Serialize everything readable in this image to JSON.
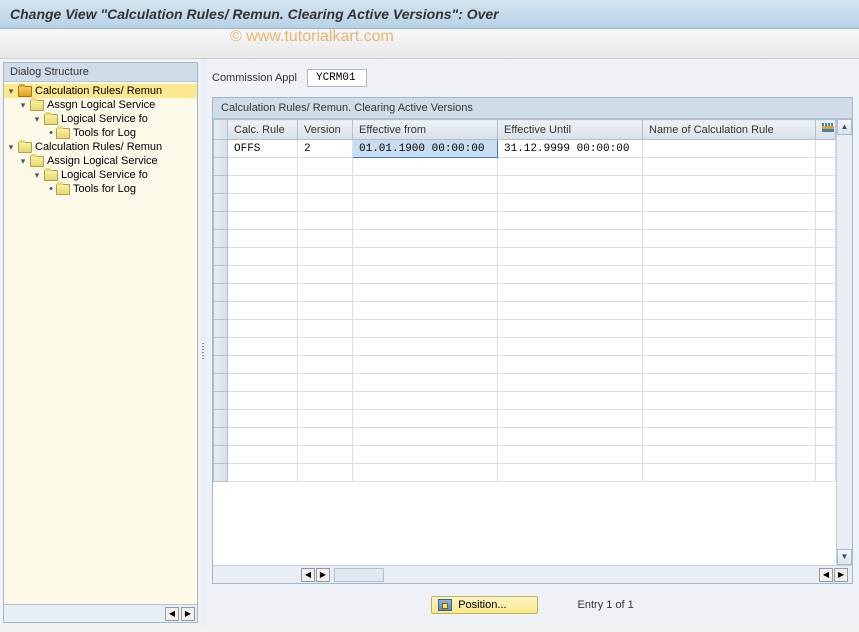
{
  "title": "Change View \"Calculation Rules/ Remun. Clearing Active Versions\": Over",
  "watermark": "© www.tutorialkart.com",
  "sidebar": {
    "title": "Dialog Structure",
    "items": [
      {
        "label": "Calculation Rules/ Remun",
        "level": 0,
        "open": true,
        "selected": true,
        "toggle": "▾"
      },
      {
        "label": "Assgn Logical Service",
        "level": 1,
        "open": true,
        "toggle": "▾"
      },
      {
        "label": "Logical Service fo",
        "level": 2,
        "open": true,
        "toggle": "▾"
      },
      {
        "label": "Tools for Log",
        "level": 3,
        "open": false,
        "toggle": "•"
      },
      {
        "label": "Calculation Rules/ Remun",
        "level": 0,
        "open": true,
        "toggle": "▾"
      },
      {
        "label": "Assign Logical Service",
        "level": 1,
        "open": true,
        "toggle": "▾"
      },
      {
        "label": "Logical Service fo",
        "level": 2,
        "open": true,
        "toggle": "▾"
      },
      {
        "label": "Tools for Log",
        "level": 3,
        "open": false,
        "toggle": "•"
      }
    ]
  },
  "form": {
    "commission_label": "Commission Appl",
    "commission_value": "YCRM01"
  },
  "table": {
    "title": "Calculation Rules/ Remun. Clearing Active Versions",
    "columns": {
      "calc_rule": "Calc. Rule",
      "version": "Version",
      "eff_from": "Effective from",
      "eff_until": "Effective Until",
      "name": "Name of Calculation Rule"
    },
    "rows": [
      {
        "calc_rule": "OFFS",
        "version": "2",
        "eff_from": "01.01.1900 00:00:00",
        "eff_until": "31.12.9999 00:00:00",
        "name": ""
      }
    ]
  },
  "footer": {
    "position_btn": "Position...",
    "entry_text": "Entry 1 of 1"
  }
}
